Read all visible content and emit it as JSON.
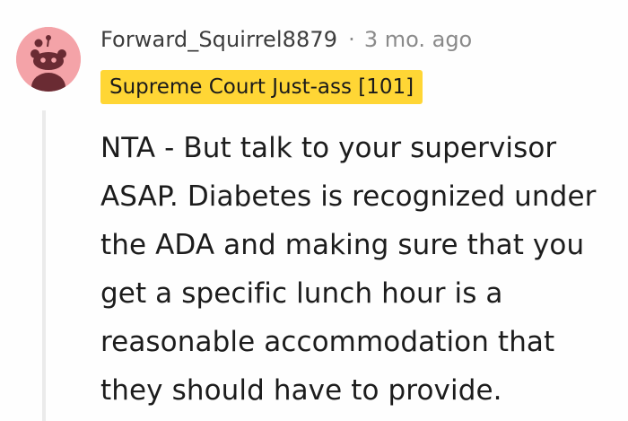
{
  "comment": {
    "username": "Forward_Squirrel8879",
    "separator": "·",
    "timestamp": "3 mo. ago",
    "flair": "Supreme Court Just-ass [101]",
    "body_lines": [
      "NTA - But talk to your supervisor",
      "ASAP. Diabetes is recognized under",
      "the ADA and making sure that you",
      "get a specific lunch hour is a",
      "reasonable accommodation that",
      "they should have to provide."
    ],
    "avatar_icon": "reddit-snoo-avatar-icon",
    "colors": {
      "avatar_bg": "#f4a3a8",
      "flair_bg": "#ffd635",
      "username": "#3c3c3c",
      "meta": "#8a8a8a",
      "body": "#1c1c1c"
    }
  }
}
